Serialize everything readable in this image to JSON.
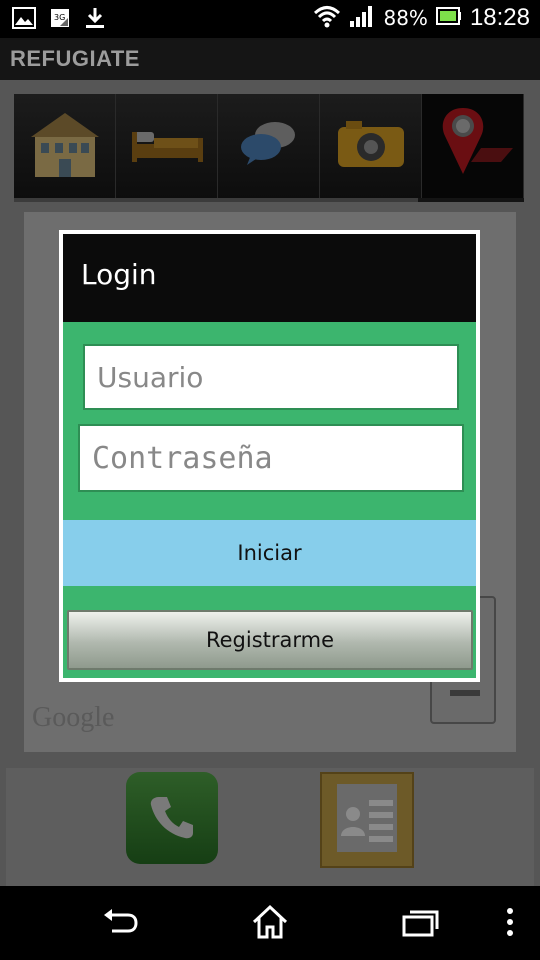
{
  "status_bar": {
    "battery_percent": "88%",
    "time": "18:28",
    "icons": [
      "gallery-icon",
      "3g-icon",
      "download-icon",
      "wifi-icon",
      "signal-icon",
      "battery-icon"
    ]
  },
  "app": {
    "title": "REFUGIATE"
  },
  "toolbar": {
    "items": [
      {
        "icon": "house-icon"
      },
      {
        "icon": "bed-icon"
      },
      {
        "icon": "chat-icon"
      },
      {
        "icon": "camera-icon"
      },
      {
        "icon": "map-pin-icon",
        "active": true
      }
    ]
  },
  "map": {
    "attribution": "Google"
  },
  "dialog": {
    "title": "Login",
    "username_placeholder": "Usuario",
    "password_placeholder": "Contraseña",
    "login_button": "Iniciar",
    "register_button": "Registrarme"
  },
  "colors": {
    "dialog_green": "#3cb56e",
    "login_button": "#87ceeb",
    "dialog_header": "#0b0b0b"
  }
}
